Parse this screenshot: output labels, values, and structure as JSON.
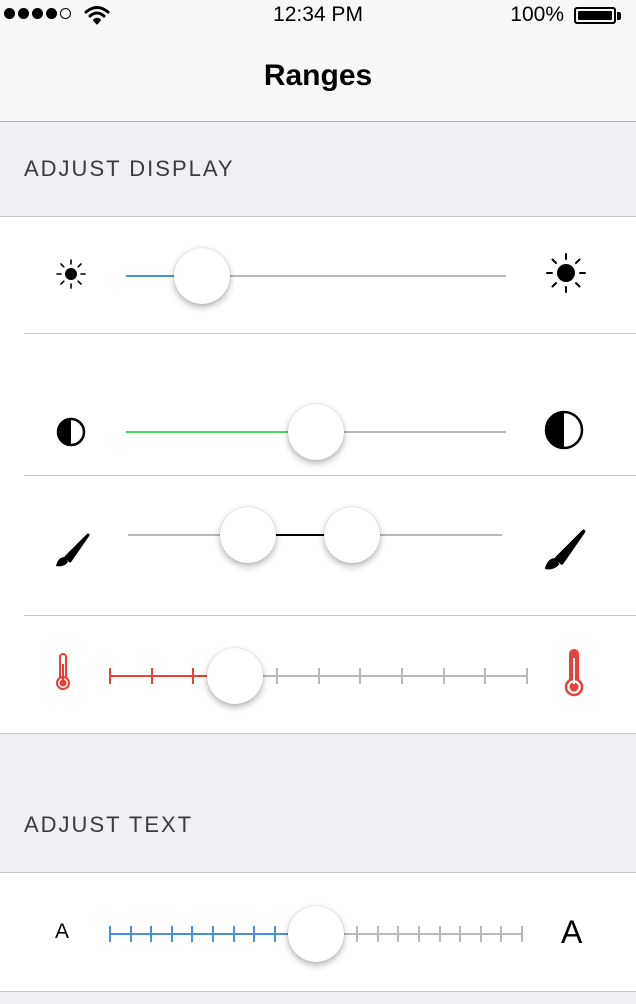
{
  "status_bar": {
    "time": "12:34 PM",
    "battery": "100%",
    "signal_bars": 4,
    "signal_total": 5
  },
  "nav": {
    "title": "Ranges"
  },
  "sections": {
    "display": {
      "header": "ADJUST DISPLAY"
    },
    "text": {
      "header": "ADJUST TEXT"
    }
  },
  "sliders": {
    "brightness": {
      "value": 0.2,
      "min_icon": "sun-small-icon",
      "max_icon": "sun-large-icon",
      "accent": "#4a90e2"
    },
    "contrast": {
      "value": 0.5,
      "min_icon": "contrast-icon",
      "max_icon": "contrast-icon",
      "accent": "#4cd964"
    },
    "brush_range": {
      "lower": 0.32,
      "upper": 0.6,
      "min_icon": "paintbrush-icon",
      "max_icon": "paintbrush-icon",
      "accent": "#000000"
    },
    "temperature": {
      "value": 0.3,
      "steps": 10,
      "min_icon": "thermometer-icon",
      "max_icon": "thermometer-icon",
      "accent": "#e8403a"
    },
    "text_size": {
      "value": 0.5,
      "steps": 20,
      "min_label": "A",
      "max_label": "A",
      "accent": "#4a90e2"
    }
  },
  "colors": {
    "track": "#b8b8b8",
    "background": "#efeff4"
  }
}
